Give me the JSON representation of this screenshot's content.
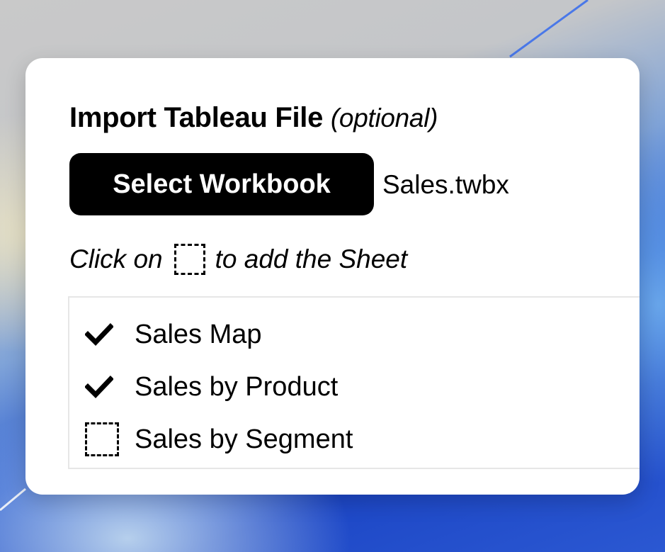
{
  "dialog": {
    "title": "Import Tableau File",
    "title_suffix": "(optional)",
    "select_button_label": "Select Workbook",
    "selected_file": "Sales.twbx",
    "instruction_prefix": "Click on",
    "instruction_suffix": "to add the Sheet",
    "instruction_icon": "dashed-square-icon"
  },
  "sheets": [
    {
      "label": "Sales Map",
      "state": "checked",
      "icon": "checkmark-icon"
    },
    {
      "label": "Sales by Product",
      "state": "checked",
      "icon": "checkmark-icon"
    },
    {
      "label": "Sales by Segment",
      "state": "unchecked",
      "icon": "dashed-square-icon"
    }
  ],
  "colors": {
    "button_bg": "#000000",
    "button_text": "#ffffff",
    "card_bg": "#ffffff",
    "list_border": "#e6e6e6",
    "wallpaper_blue": "#1d47c6"
  }
}
